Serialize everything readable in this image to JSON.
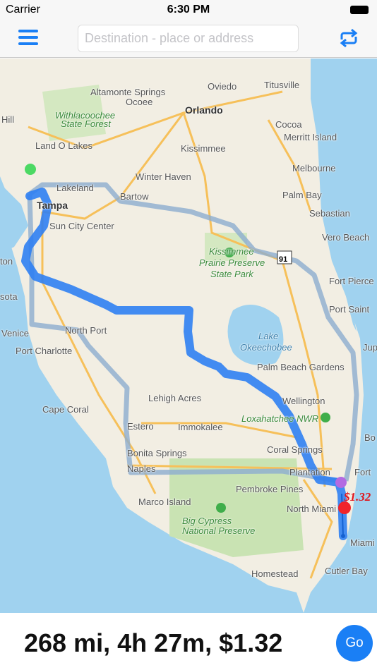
{
  "status_bar": {
    "carrier": "Carrier",
    "time": "6:30 PM"
  },
  "nav": {
    "menu_icon": "hamburger-menu-icon",
    "destination_placeholder": "Destination - place or address",
    "destination_value": "",
    "swap_icon": "refresh-arrows-icon"
  },
  "colors": {
    "accent": "#1a7ff5",
    "route": "#2f80f2",
    "alt_route": "#8eaed0",
    "land": "#f2eee3",
    "water": "#a0d2ef",
    "park": "#c9e3b3",
    "road": "#f6c05a"
  },
  "map": {
    "labels": [
      "Altamonte Springs",
      "Oviedo",
      "Titusville",
      "Ocoee",
      "Orlando",
      "Withlacoochee",
      "State Forest",
      "Hill",
      "Cocoa",
      "Merritt Island",
      "Kissimmee",
      "Land O Lakes",
      "Melbourne",
      "Winter Haven",
      "Lakeland",
      "Palm Bay",
      "Bartow",
      "Tampa",
      "Sebastian",
      "Sun City Center",
      "Vero Beach",
      "Kissimmee",
      "Prairie Preserve",
      "State Park",
      "ton",
      "Fort Pierce",
      "sota",
      "Port Saint",
      "Lake",
      "Okeechobee",
      "Venice",
      "North Port",
      "Port Charlotte",
      "Jup",
      "Palm Beach Gardens",
      "Wellington",
      "Lehigh Acres",
      "Cape Coral",
      "Loxahatchee NWR",
      "Estero",
      "Immokalee",
      "Bo",
      "Coral Springs",
      "Bonita Springs",
      "Naples",
      "Plantation",
      "Fort",
      "Pembroke Pines",
      "Marco Island",
      "North Miami",
      "Big Cypress",
      "National Preserve",
      "Miami",
      "Homestead",
      "Cutler Bay"
    ],
    "highway_shield": "91",
    "route_price": "$1.32"
  },
  "bottom": {
    "summary": "268 mi, 4h 27m, $1.32",
    "go_label": "Go"
  }
}
